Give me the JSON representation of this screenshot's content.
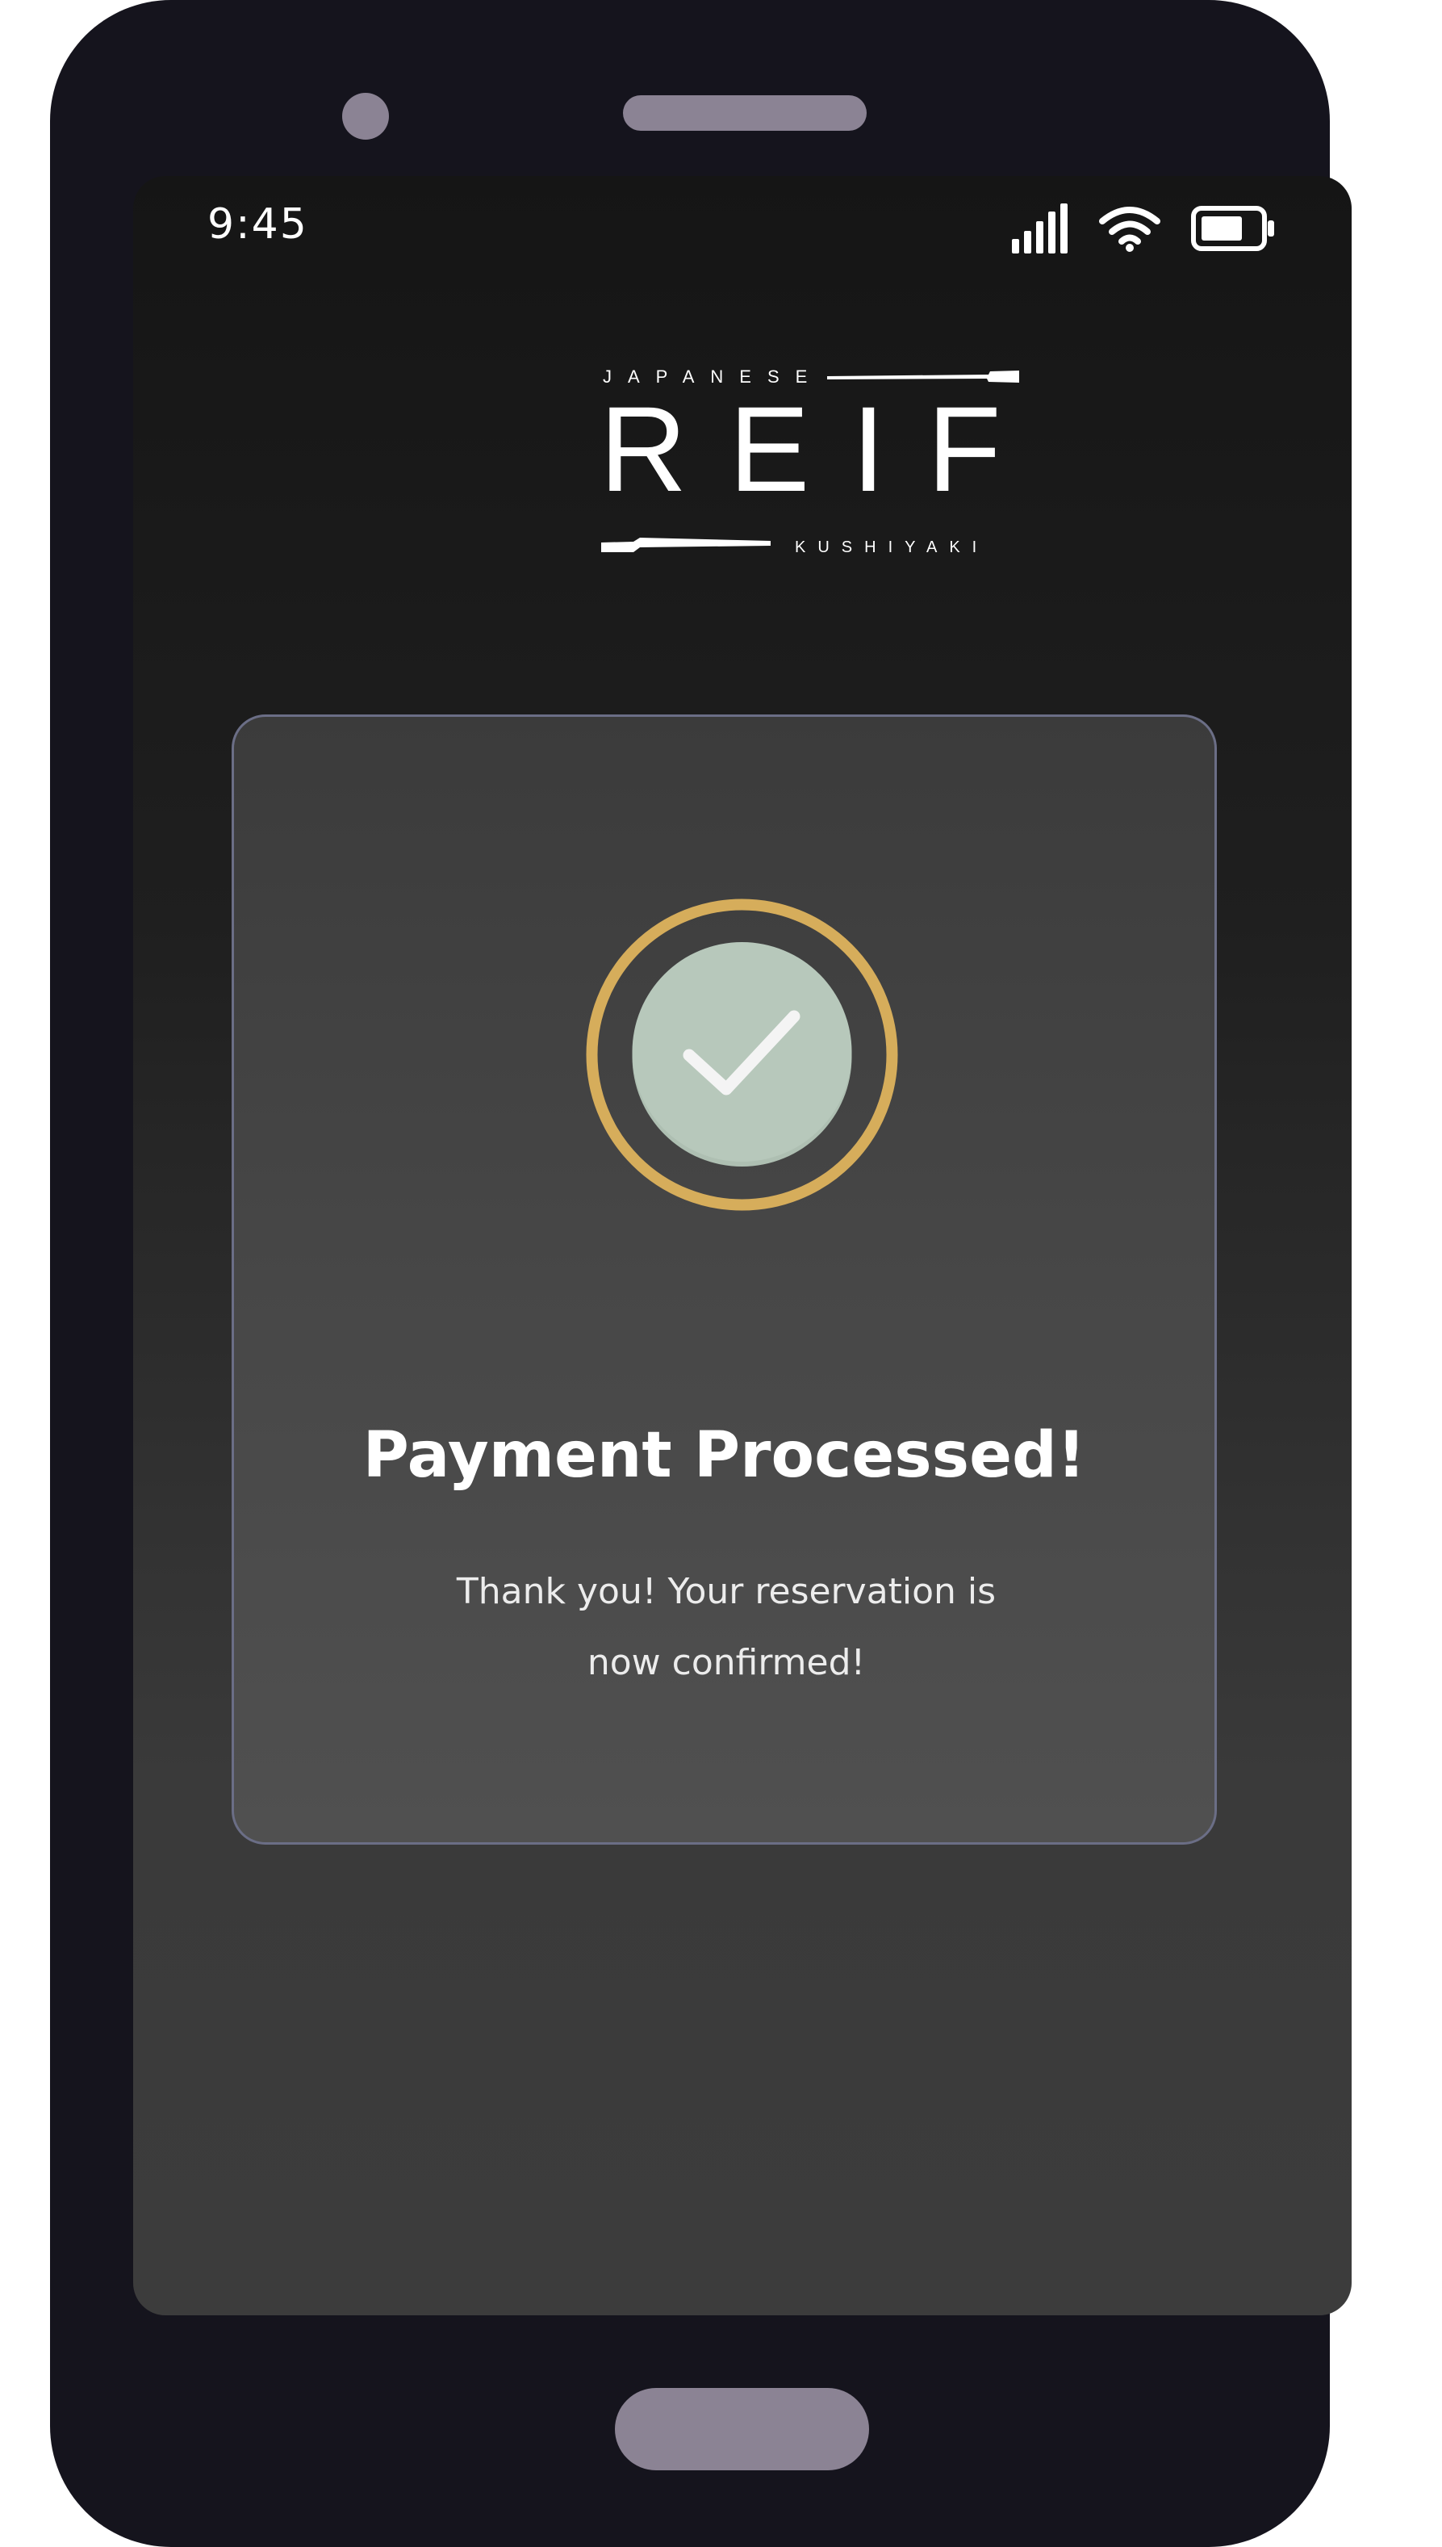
{
  "status_bar": {
    "time": "9:45",
    "icons": [
      "cellular-signal-icon",
      "wifi-icon",
      "battery-icon"
    ]
  },
  "brand": {
    "top_word": "JAPANESE",
    "name": "REIF",
    "bottom_word": "KUSHIYAKI"
  },
  "confirmation": {
    "icon": "checkmark-icon",
    "title": "Payment Processed!",
    "message_line1": "Thank you! Your reservation is",
    "message_line2": "now confirmed!"
  },
  "colors": {
    "ring": "#d6ad5b",
    "check_circle": "#b7c8bb",
    "card_border": "#6b6e86",
    "device_body": "#15141d",
    "device_accents": "#8b8394"
  }
}
